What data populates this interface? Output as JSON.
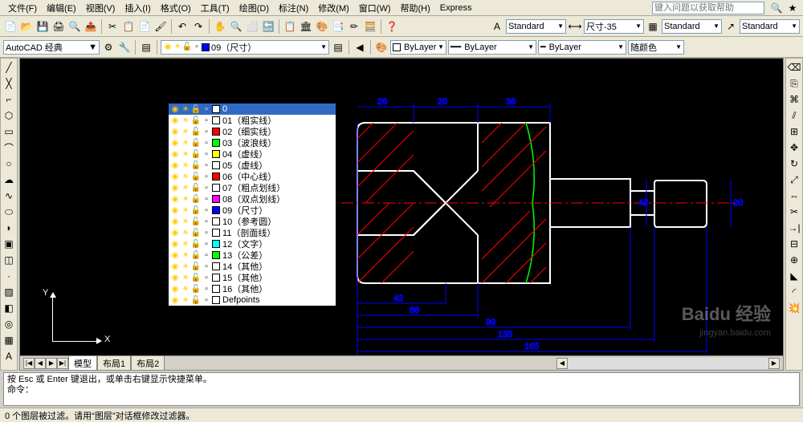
{
  "menubar": {
    "items": [
      "文件(F)",
      "编辑(E)",
      "视图(V)",
      "插入(I)",
      "格式(O)",
      "工具(T)",
      "绘图(D)",
      "标注(N)",
      "修改(M)",
      "窗口(W)",
      "帮助(H)",
      "Express"
    ],
    "help_placeholder": "键入问题以获取帮助"
  },
  "toolbar1": {
    "workspace": "AutoCAD 经典",
    "std1": "Standard",
    "std2": "尺寸-35",
    "std3": "Standard",
    "std4": "Standard"
  },
  "toolbar2": {
    "layer_current": "09（尺寸）",
    "bylayer1": "ByLayer",
    "bylayer2": "ByLayer",
    "bylayer3": "ByLayer",
    "color_label": "随颜色"
  },
  "layers": [
    {
      "name": "0",
      "color": "#ffffff",
      "selected": true
    },
    {
      "name": "01（粗实线）",
      "color": "#ffffff"
    },
    {
      "name": "02（细实线）",
      "color": "#ff0000"
    },
    {
      "name": "03（波浪线）",
      "color": "#00ff00"
    },
    {
      "name": "04（虚线）",
      "color": "#ffff00"
    },
    {
      "name": "05（虚线）",
      "color": "#ffffff"
    },
    {
      "name": "06（中心线）",
      "color": "#ff0000"
    },
    {
      "name": "07（粗点划线）",
      "color": "#ffffff"
    },
    {
      "name": "08（双点划线）",
      "color": "#ff00ff"
    },
    {
      "name": "09（尺寸）",
      "color": "#0000ff"
    },
    {
      "name": "10（参考圆）",
      "color": "#ffffff"
    },
    {
      "name": "11（剖面线）",
      "color": "#ffffff"
    },
    {
      "name": "12（文字）",
      "color": "#00ffff"
    },
    {
      "name": "13（公差）",
      "color": "#00ff00"
    },
    {
      "name": "14（其他）",
      "color": "#ffffff"
    },
    {
      "name": "15（其他）",
      "color": "#ffffff"
    },
    {
      "name": "16（其他）",
      "color": "#ffffff"
    },
    {
      "name": "Defpoints",
      "color": "#ffffff"
    }
  ],
  "ucs": {
    "x": "X",
    "y": "Y"
  },
  "tabs": {
    "model": "模型",
    "layout1": "布局1",
    "layout2": "布局2"
  },
  "cmdline": {
    "line1": "按 Esc 或 Enter 键退出，或单击右键显示快捷菜单。",
    "line2": "命令："
  },
  "statusbar": "0 个图层被过滤。请用“图层”对话框修改过滤器。",
  "dimensions": {
    "d1": "26",
    "d2": "20",
    "d3": "36",
    "d4": "42",
    "d5": "86",
    "d6": "99",
    "d7": "135",
    "d8": "165",
    "h1": "42",
    "h2": "20"
  },
  "watermark": {
    "main": "Baidu 经验",
    "sub": "jingyan.baidu.com"
  }
}
